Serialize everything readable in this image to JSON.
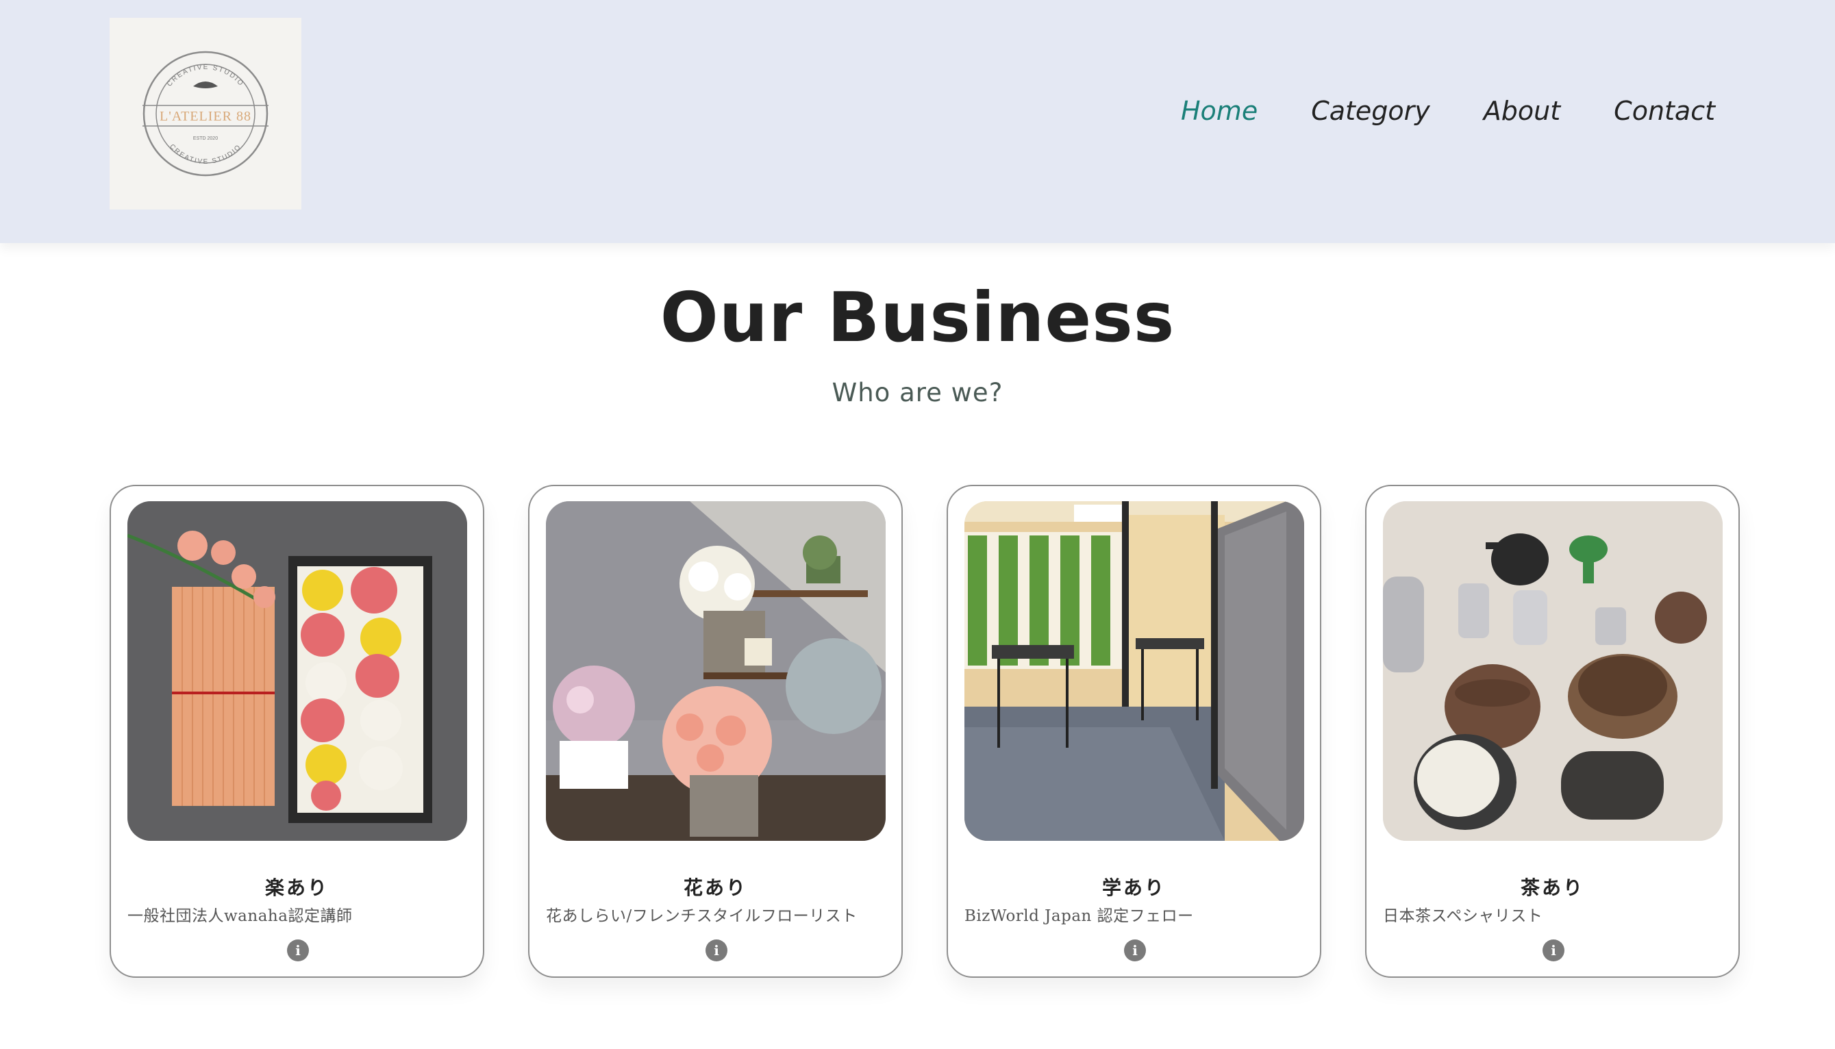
{
  "header": {
    "logo": {
      "name": "L'ATELIER 88",
      "top_text": "CREATIVE STUDIO",
      "bottom_text": "CREATIVE STUDIO",
      "small_text": "ESTD 2020"
    },
    "nav": [
      {
        "label": "Home",
        "active": true
      },
      {
        "label": "Category",
        "active": false
      },
      {
        "label": "About",
        "active": false
      },
      {
        "label": "Contact",
        "active": false
      }
    ],
    "active_color": "#1a7f78",
    "background": "#e4e8f3"
  },
  "main": {
    "title": "Our Business",
    "subtitle": "Who are we?",
    "cards": [
      {
        "title": "楽あり",
        "desc": "一般社団法人wanaha認定講師",
        "image_icon": "flower-sweets-photo",
        "info_icon": "info-icon"
      },
      {
        "title": "花あり",
        "desc": "花あしらい/フレンチスタイルフローリスト",
        "image_icon": "flower-display-photo",
        "info_icon": "info-icon"
      },
      {
        "title": "学あり",
        "desc": "BizWorld Japan 認定フェロー",
        "image_icon": "classroom-photo",
        "info_icon": "info-icon"
      },
      {
        "title": "茶あり",
        "desc": "日本茶スペシャリスト",
        "image_icon": "tea-utensils-photo",
        "info_icon": "info-icon"
      }
    ]
  }
}
